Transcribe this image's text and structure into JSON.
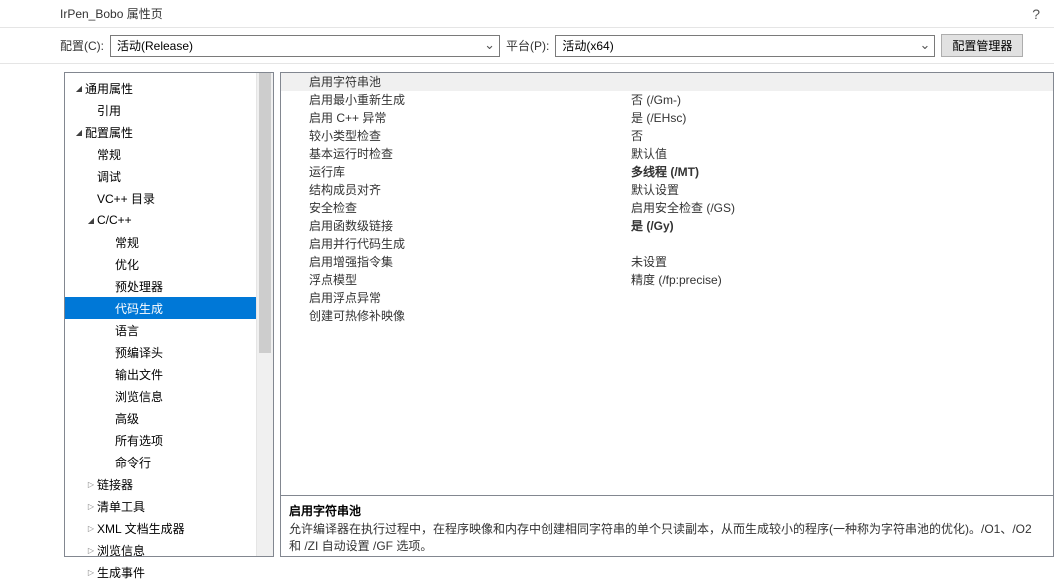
{
  "title": "IrPen_Bobo 属性页",
  "help_icon": "?",
  "toolbar": {
    "config_label": "配置(C):",
    "config_value": "活动(Release)",
    "platform_label": "平台(P):",
    "platform_value": "活动(x64)",
    "manager_button": "配置管理器"
  },
  "tree": {
    "common": "通用属性",
    "reference": "引用",
    "config_props": "配置属性",
    "general": "常规",
    "debug": "调试",
    "vcdirs": "VC++ 目录",
    "ccpp": "C/C++",
    "ccpp_general": "常规",
    "ccpp_optim": "优化",
    "ccpp_preproc": "预处理器",
    "ccpp_codegen": "代码生成",
    "ccpp_lang": "语言",
    "ccpp_precomp": "预编译头",
    "ccpp_output": "输出文件",
    "ccpp_browse": "浏览信息",
    "ccpp_advanced": "高级",
    "ccpp_allopts": "所有选项",
    "ccpp_cmdline": "命令行",
    "linker": "链接器",
    "manifest": "清单工具",
    "xmlgen": "XML 文档生成器",
    "browseinfo": "浏览信息",
    "buildevents": "生成事件"
  },
  "props": [
    {
      "label": "启用字符串池",
      "value": "",
      "current": true
    },
    {
      "label": "启用最小重新生成",
      "value": "否 (/Gm-)"
    },
    {
      "label": "启用 C++ 异常",
      "value": "是 (/EHsc)"
    },
    {
      "label": "较小类型检查",
      "value": "否"
    },
    {
      "label": "基本运行时检查",
      "value": "默认值"
    },
    {
      "label": "运行库",
      "value": "多线程 (/MT)",
      "bold": true
    },
    {
      "label": "结构成员对齐",
      "value": "默认设置"
    },
    {
      "label": "安全检查",
      "value": "启用安全检查 (/GS)"
    },
    {
      "label": "启用函数级链接",
      "value": "是 (/Gy)",
      "bold": true
    },
    {
      "label": "启用并行代码生成",
      "value": ""
    },
    {
      "label": "启用增强指令集",
      "value": "未设置"
    },
    {
      "label": "浮点模型",
      "value": "精度 (/fp:precise)"
    },
    {
      "label": "启用浮点异常",
      "value": ""
    },
    {
      "label": "创建可热修补映像",
      "value": ""
    }
  ],
  "description": {
    "title": "启用字符串池",
    "text": "允许编译器在执行过程中，在程序映像和内存中创建相同字符串的单个只读副本，从而生成较小的程序(一种称为字符串池的优化)。/O1、/O2 和 /ZI 自动设置 /GF 选项。"
  }
}
